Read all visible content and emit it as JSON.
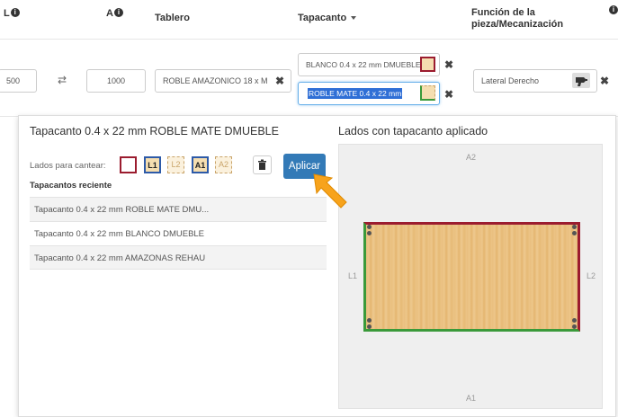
{
  "header": {
    "col_l": "L",
    "col_a": "A",
    "col_tablero": "Tablero",
    "col_tapacanto": "Tapacanto",
    "col_funcion": "Función de la pieza/Mecanización"
  },
  "row": {
    "l_value": "500",
    "swap_symbol": "⇄",
    "a_value": "1000",
    "tablero_value": "ROBLE AMAZONICO 18 x M",
    "tapacanto_1": "BLANCO 0.4 x 22 mm DMUEBLE",
    "tapacanto_2": "ROBLE MATE 0.4 x 22 mm",
    "funcion_value": "Lateral Derecho"
  },
  "popup": {
    "title": "Tapacanto 0.4 x 22 mm ROBLE MATE DMUEBLE",
    "sides_label": "Lados para cantear:",
    "side_l1": "L1",
    "side_l2": "L2",
    "side_a1": "A1",
    "side_a2": "A2",
    "apply_label": "Aplicar",
    "recent_heading": "Tapacantos reciente",
    "recent": [
      "Tapacanto 0.4 x 22 mm ROBLE MATE DMU...",
      "Tapacanto 0.4 x 22 mm BLANCO DMUEBLE",
      "Tapacanto 0.4 x 22 mm AMAZONAS REHAU"
    ],
    "preview_heading": "Lados con tapacanto aplicado",
    "preview": {
      "top": "A2",
      "bottom": "A1",
      "left": "L1",
      "right": "L2"
    }
  },
  "colors": {
    "primary": "#337ab7",
    "edge_red": "#9b1c2f",
    "edge_green": "#3a9a3a",
    "arrow": "#f7a31c",
    "selection": "#2f6fd6"
  }
}
